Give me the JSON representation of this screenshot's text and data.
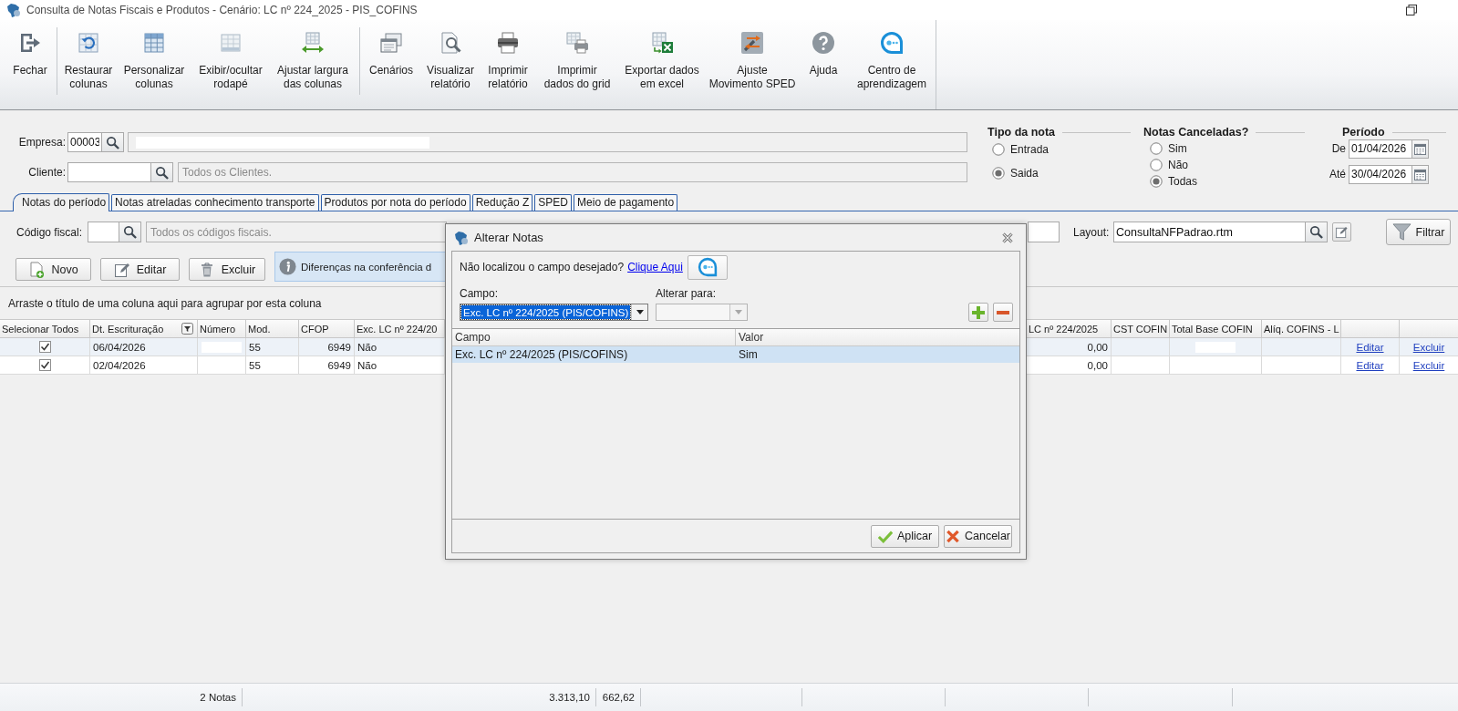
{
  "window": {
    "title": "Consulta de Notas Fiscais e Produtos - Cenário: LC nº 224_2025 - PIS_COFINS"
  },
  "toolbar": {
    "groups": [
      [
        {
          "label": "Fechar"
        }
      ],
      [
        {
          "label": "Restaurar\ncolunas"
        },
        {
          "label": "Personalizar\ncolunas"
        },
        {
          "label": "Exibir/ocultar\nrodapé"
        },
        {
          "label": "Ajustar largura\ndas colunas"
        }
      ],
      [
        {
          "label": "Cenários"
        },
        {
          "label": "Visualizar\nrelatório"
        },
        {
          "label": "Imprimir\nrelatório"
        },
        {
          "label": "Imprimir\ndados do grid"
        },
        {
          "label": "Exportar dados\nem excel"
        },
        {
          "label": "Ajuste\nMovimento SPED"
        },
        {
          "label": "Ajuda"
        },
        {
          "label": "Centro de\naprendizagem"
        }
      ]
    ]
  },
  "filters": {
    "empresa": {
      "label": "Empresa:",
      "value": "00003"
    },
    "cliente": {
      "label": "Cliente:",
      "placeholder": "Todos os Clientes."
    },
    "tipo_da_nota": {
      "title": "Tipo da nota",
      "options": [
        {
          "label": "Entrada",
          "selected": false
        },
        {
          "label": "Saida",
          "selected": true
        }
      ]
    },
    "notas_canceladas": {
      "title": "Notas Canceladas?",
      "options": [
        {
          "label": "Sim",
          "selected": false
        },
        {
          "label": "Não",
          "selected": false
        },
        {
          "label": "Todas",
          "selected": true
        }
      ]
    },
    "periodo": {
      "title": "Período",
      "fields": [
        {
          "label": "De",
          "value": "01/04/2026"
        },
        {
          "label": "Até",
          "value": "30/04/2026"
        }
      ]
    }
  },
  "tabs": [
    {
      "label": "Notas do período",
      "selected": true
    },
    {
      "label": "Notas atreladas conhecimento transporte",
      "selected": false
    },
    {
      "label": "Produtos por nota do período",
      "selected": false
    },
    {
      "label": "Redução Z",
      "selected": false
    },
    {
      "label": "SPED",
      "selected": false
    },
    {
      "label": "Meio de pagamento",
      "selected": false
    }
  ],
  "tab_content": {
    "codigo_fiscal": {
      "label": "Código fiscal:",
      "placeholder": "Todos os códigos fiscais."
    },
    "layout": {
      "label": "Layout:",
      "value": "ConsultaNFPadrao.rtm"
    },
    "filter_button": "Filtrar",
    "actions": [
      "Novo",
      "Editar",
      "Excluir"
    ],
    "info_banner": "Diferenças na conferência d",
    "group_hint": "Arraste o título de uma coluna aqui para agrupar por esta coluna",
    "grid": {
      "columns": [
        {
          "title": "Selecionar Todos",
          "kind": "check"
        },
        {
          "title": "Dt. Escrituração",
          "kind": "text",
          "filter_button": true
        },
        {
          "title": "Número",
          "kind": "redacted"
        },
        {
          "title": "Mod.",
          "kind": "text"
        },
        {
          "title": "CFOP",
          "kind": "number"
        },
        {
          "title": "Exc. LC nº 224/20",
          "kind": "text"
        },
        {
          "title": "LC nº 224/2025",
          "kind": "number"
        },
        {
          "title": "CST COFIN",
          "kind": "blank"
        },
        {
          "title": "Total Base COFIN",
          "kind": "redacted"
        },
        {
          "title": "Alíq. COFINS - L",
          "kind": "blank"
        },
        {
          "kind": "link"
        },
        {
          "kind": "link"
        }
      ],
      "rows": [
        {
          "selected": true,
          "checked": true,
          "cells": [
            "",
            "06/04/2026",
            "",
            "55",
            "6949",
            "Não",
            "0,00",
            "",
            "",
            "",
            "Editar",
            "Excluir"
          ]
        },
        {
          "selected": false,
          "checked": true,
          "cells": [
            "",
            "02/04/2026",
            "",
            "55",
            "6949",
            "Não",
            "0,00",
            "",
            "",
            "",
            "Editar",
            "Excluir"
          ]
        }
      ]
    }
  },
  "dialog": {
    "title": "Alterar Notas",
    "hint": "Não localizou o campo desejado?",
    "link": "Clique Aqui",
    "campo": {
      "label": "Campo:",
      "value": "Exc. LC nº 224/2025 (PIS/COFINS)",
      "focused": true
    },
    "alterar_para": {
      "label": "Alterar para:",
      "disabled": true
    },
    "table": {
      "columns": [
        "Campo",
        "Valor"
      ],
      "rows": [
        {
          "selected": true,
          "cells": [
            "Exc. LC nº 224/2025 (PIS/COFINS)",
            "Sim"
          ]
        }
      ]
    },
    "buttons": [
      "Aplicar",
      "Cancelar"
    ]
  },
  "status_bar": {
    "cells": [
      "2 Notas",
      "3.313,10",
      "662,62"
    ]
  }
}
